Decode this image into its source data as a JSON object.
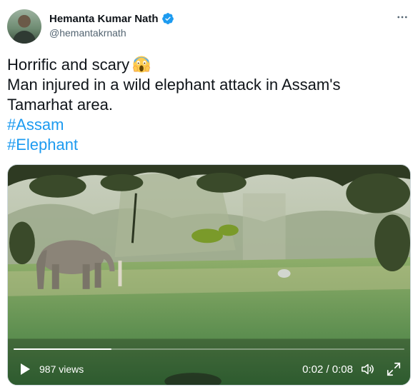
{
  "author": {
    "display_name": "Hemanta Kumar Nath",
    "handle": "@hemantakrnath",
    "verified": true
  },
  "tweet": {
    "line1": "Horrific and scary",
    "line1_emoji": "screaming-face-emoji",
    "line2": "Man injured in a wild elephant attack in Assam's",
    "line3": "Tamarhat area.",
    "hashtags": [
      "#Assam",
      "#Elephant"
    ]
  },
  "video": {
    "views": "987 views",
    "time": "0:02 / 0:08",
    "progress": 0.25
  },
  "colors": {
    "link": "#1d9bf0",
    "verified": "#1d9bf0",
    "text": "#0f1419",
    "secondary": "#536471"
  },
  "icons": {
    "more": "more-icon",
    "play": "play-icon",
    "volume": "volume-icon",
    "fullscreen": "fullscreen-icon"
  }
}
